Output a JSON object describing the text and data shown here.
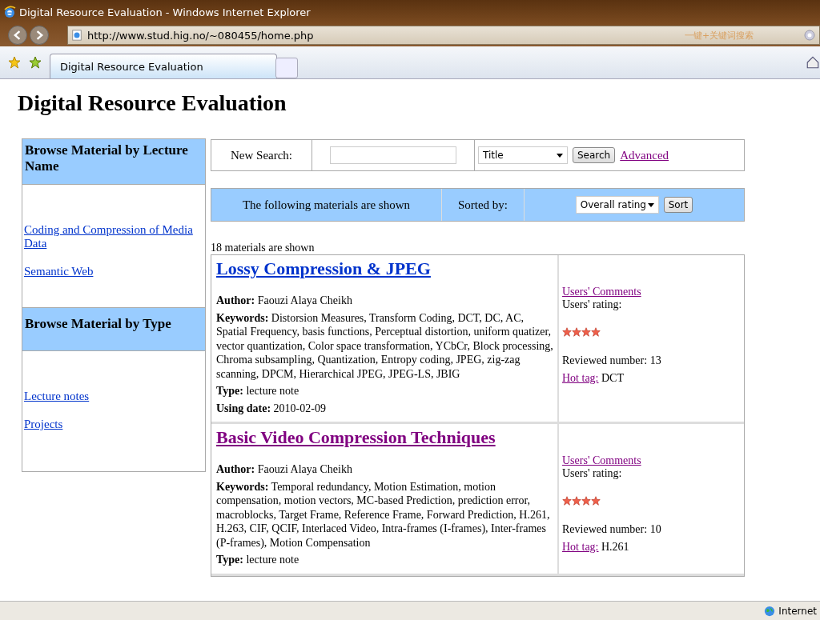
{
  "window": {
    "title": "Digital Resource Evaluation - Windows Internet Explorer"
  },
  "address_bar": {
    "url": "http://www.stud.hig.no/~080455/home.php",
    "search_placeholder": "一键+关键词搜索"
  },
  "tabs": [
    {
      "label": "Digital Resource Evaluation",
      "selected": true
    }
  ],
  "page_title": "Digital Resource Evaluation",
  "sidebar": [
    {
      "heading": "Browse Material by Lecture Name",
      "links": [
        "Coding and Compression of Media Data",
        "Semantic Web"
      ]
    },
    {
      "heading": "Browse Material by Type",
      "links": [
        "Lecture notes",
        "Projects"
      ]
    }
  ],
  "search": {
    "label": "New Search:",
    "field_by": "Title",
    "button": "Search",
    "advanced": "Advanced"
  },
  "sort_bar": {
    "caption": "The following materials are shown",
    "label": "Sorted by:",
    "sort_by": "Overall rating",
    "button": "Sort"
  },
  "count": "18 materials are shown",
  "materials": [
    {
      "title": "Lossy Compression & JPEG",
      "visited": false,
      "author_label": "Author:",
      "keywords_label": "Keywords:",
      "type_label": "Type:",
      "using_date_label": "Using date:",
      "author": "Faouzi Alaya Cheikh",
      "keywords": "Distorsion Measures, Transform Coding, DCT, DC, AC, Spatial Frequency, basis functions, Perceptual distortion, uniform quatizer, vector quantization, Color space transformation, YCbCr, Block processing, Chroma subsampling, Quantization, Entropy coding, JPEG, zig-zag scanning, DPCM, Hierarchical JPEG, JPEG-LS, JBIG",
      "type": "lecture note",
      "using_date": "2010-02-09",
      "comments": "Users' Comments",
      "rating_label": "Users' rating:",
      "stars": 4,
      "reviewed": "Reviewed number: 13",
      "hot_tag_label": "Hot tag:",
      "hot_tag": "DCT"
    },
    {
      "title": "Basic Video Compression Techniques",
      "visited": true,
      "author_label": "Author:",
      "keywords_label": "Keywords:",
      "type_label": "Type:",
      "author": "Faouzi Alaya Cheikh",
      "keywords": "Temporal redundancy, Motion Estimation, motion compensation, motion vectors, MC-based Prediction, prediction error, macroblocks, Target Frame, Reference Frame, Forward Prediction, H.261, H.263, CIF, QCIF, Interlaced Video, Intra-frames (I-frames), Inter-frames (P-frames), Motion Compensation",
      "type": "lecture note",
      "comments": "Users' Comments",
      "rating_label": "Users' rating:",
      "stars": 4,
      "reviewed": "Reviewed number: 10",
      "hot_tag_label": "Hot tag:",
      "hot_tag": "H.261"
    }
  ],
  "status_bar": {
    "zone": "Internet"
  }
}
